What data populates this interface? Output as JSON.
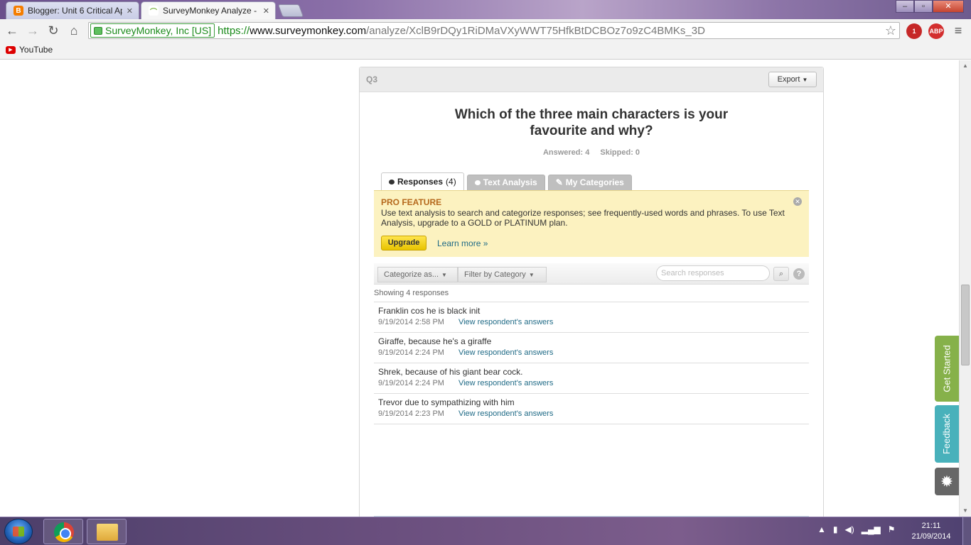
{
  "browser": {
    "tabs": [
      {
        "title": "Blogger: Unit 6 Critical Ap",
        "icon": "blogger-icon"
      },
      {
        "title": "SurveyMonkey Analyze - (",
        "icon": "surveymonkey-icon"
      }
    ],
    "ev_label": "SurveyMonkey, Inc [US]",
    "url_scheme": "https://",
    "url_host": "www.surveymonkey.com",
    "url_path": "/analyze/XclB9rDQy1RiDMaVXyWWT75HfkBtDCBOz7o9zC4BMKs_3D",
    "extensions": [
      {
        "name": "ext-red-icon",
        "badge": "1",
        "color": "#c62828"
      },
      {
        "name": "adblock-icon",
        "badge": "1",
        "color": "#d32f2f",
        "label": "ABP"
      }
    ],
    "bookmarks": [
      {
        "label": "YouTube",
        "icon": "youtube-icon"
      }
    ]
  },
  "question": {
    "number": "Q3",
    "export_label": "Export",
    "title": "Which of the three main characters is your favourite and why?",
    "answered": "Answered: 4",
    "skipped": "Skipped: 0"
  },
  "tabs": [
    {
      "label": "Responses",
      "count": "(4)",
      "active": true
    },
    {
      "label": "Text Analysis",
      "active": false
    },
    {
      "label": "My Categories",
      "active": false
    }
  ],
  "pro": {
    "title": "PRO FEATURE",
    "text": "Use text analysis to search and categorize responses; see frequently-used words and phrases. To use Text Analysis, upgrade to a GOLD or PLATINUM plan.",
    "upgrade_label": "Upgrade",
    "learn_more": "Learn more »"
  },
  "filters": {
    "categorize": "Categorize as...",
    "filter": "Filter by Category",
    "search_placeholder": "Search responses",
    "help": "?"
  },
  "showing": "Showing 4 responses",
  "responses": [
    {
      "text": "Franklin cos he is black init",
      "date": "9/19/2014 2:58 PM",
      "link": "View respondent's answers"
    },
    {
      "text": "Giraffe, because he's a giraffe",
      "date": "9/19/2014 2:24 PM",
      "link": "View respondent's answers"
    },
    {
      "text": "Shrek, because of his giant bear cock.",
      "date": "9/19/2014 2:24 PM",
      "link": "View respondent's answers"
    },
    {
      "text": "Trevor due to sympathizing with him",
      "date": "9/19/2014 2:23 PM",
      "link": "View respondent's answers"
    }
  ],
  "side": {
    "get_started": "Get Started",
    "feedback": "Feedback",
    "colors": {
      "get_started": "#86b14a",
      "feedback": "#48b1bb",
      "bug": "#666666"
    }
  },
  "taskbar": {
    "time": "21:11",
    "date": "21/09/2014"
  },
  "colors": {
    "pro_bg": "#fcf2c0",
    "pro_title": "#b5681c",
    "link": "#1f6a86",
    "ev_green": "#1a8a1a"
  }
}
